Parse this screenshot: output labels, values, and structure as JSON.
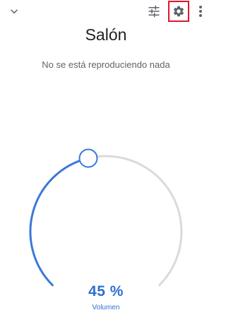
{
  "header": {
    "collapse_icon": "chevron-down-icon",
    "equalizer_icon": "equalizer-icon",
    "settings_icon": "gear-icon",
    "more_icon": "more-vert-icon",
    "highlight_color": "#e0162b"
  },
  "main": {
    "title": "Salón",
    "status": "No se está reproduciendo nada"
  },
  "volume": {
    "level": 0.45,
    "value_text": "45 %",
    "label": "Volumen",
    "active_color": "#3b78d8",
    "track_color": "#dadada"
  }
}
